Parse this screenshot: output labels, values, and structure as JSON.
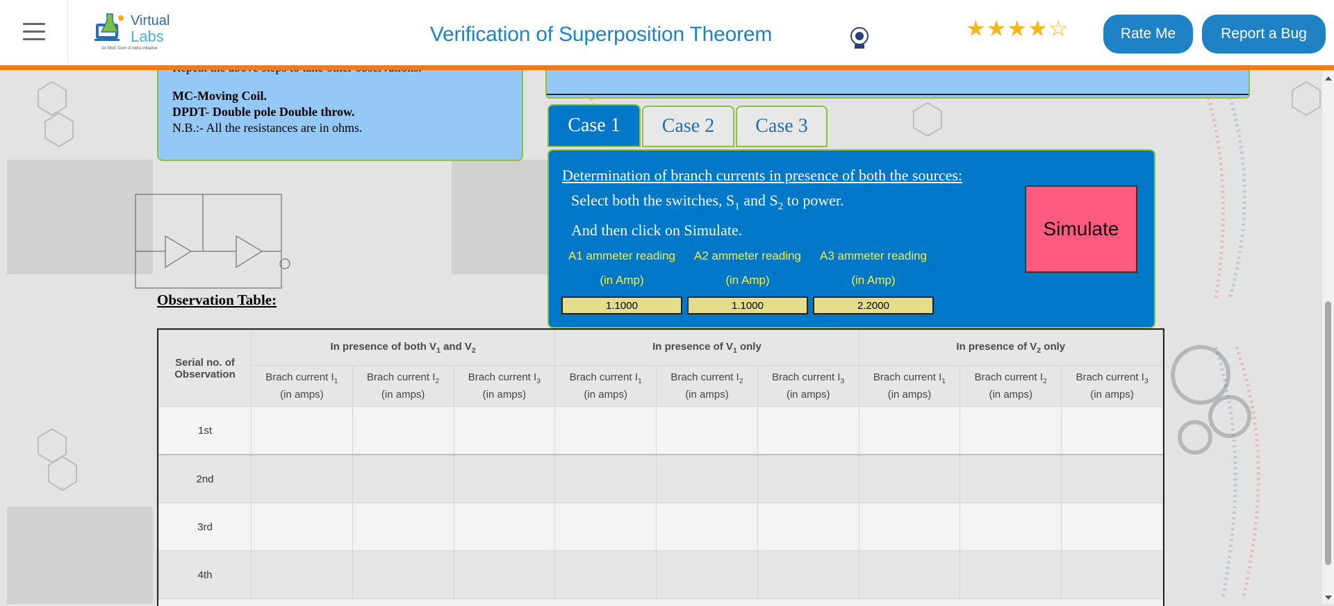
{
  "header": {
    "logo_primary": "Virtual",
    "logo_secondary": "Labs",
    "logo_tagline": "An MoE Govt of India Initiative",
    "title": "Verification of Superposition Theorem",
    "rating_filled": 4,
    "rating_max": 5,
    "stars_filled": "★★★★",
    "stars_empty": "☆",
    "rate_label": "Rate Me",
    "bug_label": "Report a Bug"
  },
  "instructions": {
    "cut_line": "Repeat the above steps to take other observations.",
    "mc": "MC-Moving Coil.",
    "dpdt": "DPDT- Double pole Double throw.",
    "nb": "N.B.:- All the resistances are in ohms."
  },
  "tabs": [
    {
      "label": "Case 1",
      "active": true
    },
    {
      "label": "Case 2",
      "active": false
    },
    {
      "label": "Case 3",
      "active": false
    }
  ],
  "sim": {
    "heading": "Determination of branch currents in presence of both the sources:",
    "line1_a": "Select both the switches, S",
    "line1_s1": "1",
    "line1_b": " and S",
    "line1_s2": "2",
    "line1_c": " to power.",
    "line2": "And then click on Simulate.",
    "simulate_label": "Simulate",
    "meters": [
      {
        "label": "A1 ammeter reading",
        "unit": "(in Amp)",
        "value": "1.1000"
      },
      {
        "label": "A2 ammeter reading",
        "unit": "(in Amp)",
        "value": "1.1000"
      },
      {
        "label": "A3 ammeter reading",
        "unit": "(in Amp)",
        "value": "2.2000"
      }
    ]
  },
  "observation": {
    "title": "Observation Table:",
    "serial_header": "Serial no. of Observation",
    "group_both_a": "In presence of both V",
    "group_both_s1": "1",
    "group_both_b": " and V",
    "group_both_s2": "2",
    "group_v1_a": "In presence of V",
    "group_v1_s": "1",
    "group_v1_b": " only",
    "group_v2_a": "In presence of V",
    "group_v2_s": "2",
    "group_v2_b": " only",
    "col_prefix": "Brach current I",
    "col_unit": "(in amps)",
    "col_subs": [
      "1",
      "2",
      "3"
    ],
    "rows": [
      "1st",
      "2nd",
      "3rd",
      "4th"
    ]
  },
  "colors": {
    "accent_blue": "#1e82c5",
    "panel_blue": "#0078c8",
    "orange_bar": "#f27a1a",
    "simulate_pink": "#fd5a80",
    "meter_label_yellow": "#ffef3c"
  }
}
